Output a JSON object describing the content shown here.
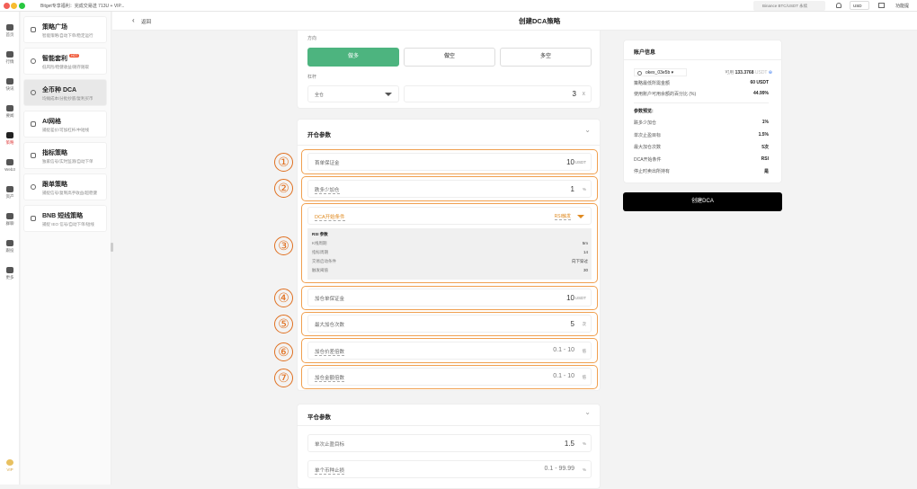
{
  "titlebar": {
    "tab": "Bitget专享福利：完成交易送 713U + VIP...",
    "search": "Binance BTC/USDT 永续",
    "currency": "USD",
    "feature": "功能提"
  },
  "rail": [
    {
      "label": "首页"
    },
    {
      "label": "行情"
    },
    {
      "label": "快讯"
    },
    {
      "label": "要闻"
    },
    {
      "label": "策略"
    },
    {
      "label": "Web3"
    },
    {
      "label": "资产"
    },
    {
      "label": "群聊"
    },
    {
      "label": "跟投"
    },
    {
      "label": "更多"
    },
    {
      "label": "VIP"
    }
  ],
  "menu": [
    {
      "title": "策略广场",
      "sub": "智能策略/自动下单/稳定运行"
    },
    {
      "title": "智能套利",
      "badge": "HOT",
      "sub": "低风险/稳健收益/随存随取"
    },
    {
      "title": "全币种 DCA",
      "sub": "均摊成本/分批抄底/复利买币"
    },
    {
      "title": "AI网格",
      "sub": "捕捉差价/可加杠杆/中短线"
    },
    {
      "title": "指标策略",
      "sub": "独家信号/实时监测/自动下单"
    },
    {
      "title": "跟单策略",
      "sub": "捕捉信号/复制高手收益/超稳健"
    },
    {
      "title": "BNB 短线策略",
      "sub": "捕捉 IEO 信号/自动下单/短线"
    }
  ],
  "header": {
    "back": "返回",
    "title": "创建DCA策略"
  },
  "direction": {
    "label": "方向",
    "options": [
      "做多",
      "做空",
      "多空"
    ],
    "selected": "做多"
  },
  "leverage": {
    "label": "杠杆",
    "mode": "全仓",
    "value": "3",
    "unit": "X"
  },
  "open": {
    "title": "开仓参数",
    "first_margin": {
      "label": "首单保证金",
      "value": "10",
      "unit": "USDT"
    },
    "drop": {
      "label": "跌多少加仓",
      "value": "1",
      "unit": "%"
    },
    "dca_condition": {
      "label": "DCA开始条件",
      "value": "RSI触发"
    },
    "rsi": {
      "title": "RSI 参数",
      "rows": [
        {
          "k": "K线周期",
          "v": "5m"
        },
        {
          "k": "指标周期",
          "v": "14"
        },
        {
          "k": "交易启动条件",
          "v": "向下穿过"
        },
        {
          "k": "触发阈值",
          "v": "30"
        }
      ]
    },
    "add_margin": {
      "label": "加仓单保证金",
      "value": "10",
      "unit": "USDT"
    },
    "max_adds": {
      "label": "最大加仓次数",
      "value": "5",
      "unit": "次"
    },
    "price_mult": {
      "label": "加仓价差倍数",
      "value": "0.1 - 10",
      "unit": "倍"
    },
    "amount_mult": {
      "label": "加仓金额倍数",
      "value": "0.1 - 10",
      "unit": "倍"
    }
  },
  "close": {
    "title": "平仓参数",
    "tp": {
      "label": "单次止盈目标",
      "value": "1.5",
      "unit": "%"
    },
    "sl": {
      "label": "单个币种止损",
      "value": "0.1 - 99.99",
      "unit": "%"
    }
  },
  "annotations": [
    "①",
    "②",
    "③",
    "④",
    "⑤",
    "⑥",
    "⑦"
  ],
  "account": {
    "title": "账户信息",
    "name": "okex_03e5b",
    "avail_label": "可用",
    "avail": "133.3768",
    "avail_unit": "USDT",
    "min_label": "策略最低所需金额",
    "min": "60 USDT",
    "pct_label": "使用账户可用余额的百分比 (%)",
    "pct": "44.99%",
    "preview_title": "参数预览:",
    "preview": [
      {
        "k": "跌多少加仓",
        "v": "1%"
      },
      {
        "k": "单次止盈目标",
        "v": "1.5%"
      },
      {
        "k": "最大加仓次数",
        "v": "5次"
      },
      {
        "k": "DCA开始条件",
        "v": "RSI"
      },
      {
        "k": "停止时卖出所持有",
        "v": "是"
      }
    ]
  },
  "create_button": "创建DCA",
  "colors": {
    "green": "#4db47f",
    "orange": "#f0a050",
    "accent": "#e07020"
  }
}
